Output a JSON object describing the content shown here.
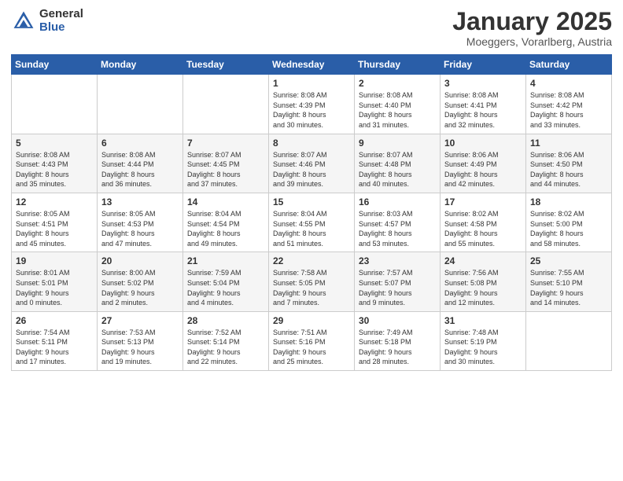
{
  "logo": {
    "general": "General",
    "blue": "Blue"
  },
  "header": {
    "month": "January 2025",
    "location": "Moeggers, Vorarlberg, Austria"
  },
  "weekdays": [
    "Sunday",
    "Monday",
    "Tuesday",
    "Wednesday",
    "Thursday",
    "Friday",
    "Saturday"
  ],
  "weeks": [
    [
      {
        "day": "",
        "sunrise": "",
        "sunset": "",
        "daylight": ""
      },
      {
        "day": "",
        "sunrise": "",
        "sunset": "",
        "daylight": ""
      },
      {
        "day": "",
        "sunrise": "",
        "sunset": "",
        "daylight": ""
      },
      {
        "day": "1",
        "sunrise": "Sunrise: 8:08 AM",
        "sunset": "Sunset: 4:39 PM",
        "daylight": "Daylight: 8 hours and 30 minutes."
      },
      {
        "day": "2",
        "sunrise": "Sunrise: 8:08 AM",
        "sunset": "Sunset: 4:40 PM",
        "daylight": "Daylight: 8 hours and 31 minutes."
      },
      {
        "day": "3",
        "sunrise": "Sunrise: 8:08 AM",
        "sunset": "Sunset: 4:41 PM",
        "daylight": "Daylight: 8 hours and 32 minutes."
      },
      {
        "day": "4",
        "sunrise": "Sunrise: 8:08 AM",
        "sunset": "Sunset: 4:42 PM",
        "daylight": "Daylight: 8 hours and 33 minutes."
      }
    ],
    [
      {
        "day": "5",
        "sunrise": "Sunrise: 8:08 AM",
        "sunset": "Sunset: 4:43 PM",
        "daylight": "Daylight: 8 hours and 35 minutes."
      },
      {
        "day": "6",
        "sunrise": "Sunrise: 8:08 AM",
        "sunset": "Sunset: 4:44 PM",
        "daylight": "Daylight: 8 hours and 36 minutes."
      },
      {
        "day": "7",
        "sunrise": "Sunrise: 8:07 AM",
        "sunset": "Sunset: 4:45 PM",
        "daylight": "Daylight: 8 hours and 37 minutes."
      },
      {
        "day": "8",
        "sunrise": "Sunrise: 8:07 AM",
        "sunset": "Sunset: 4:46 PM",
        "daylight": "Daylight: 8 hours and 39 minutes."
      },
      {
        "day": "9",
        "sunrise": "Sunrise: 8:07 AM",
        "sunset": "Sunset: 4:48 PM",
        "daylight": "Daylight: 8 hours and 40 minutes."
      },
      {
        "day": "10",
        "sunrise": "Sunrise: 8:06 AM",
        "sunset": "Sunset: 4:49 PM",
        "daylight": "Daylight: 8 hours and 42 minutes."
      },
      {
        "day": "11",
        "sunrise": "Sunrise: 8:06 AM",
        "sunset": "Sunset: 4:50 PM",
        "daylight": "Daylight: 8 hours and 44 minutes."
      }
    ],
    [
      {
        "day": "12",
        "sunrise": "Sunrise: 8:05 AM",
        "sunset": "Sunset: 4:51 PM",
        "daylight": "Daylight: 8 hours and 45 minutes."
      },
      {
        "day": "13",
        "sunrise": "Sunrise: 8:05 AM",
        "sunset": "Sunset: 4:53 PM",
        "daylight": "Daylight: 8 hours and 47 minutes."
      },
      {
        "day": "14",
        "sunrise": "Sunrise: 8:04 AM",
        "sunset": "Sunset: 4:54 PM",
        "daylight": "Daylight: 8 hours and 49 minutes."
      },
      {
        "day": "15",
        "sunrise": "Sunrise: 8:04 AM",
        "sunset": "Sunset: 4:55 PM",
        "daylight": "Daylight: 8 hours and 51 minutes."
      },
      {
        "day": "16",
        "sunrise": "Sunrise: 8:03 AM",
        "sunset": "Sunset: 4:57 PM",
        "daylight": "Daylight: 8 hours and 53 minutes."
      },
      {
        "day": "17",
        "sunrise": "Sunrise: 8:02 AM",
        "sunset": "Sunset: 4:58 PM",
        "daylight": "Daylight: 8 hours and 55 minutes."
      },
      {
        "day": "18",
        "sunrise": "Sunrise: 8:02 AM",
        "sunset": "Sunset: 5:00 PM",
        "daylight": "Daylight: 8 hours and 58 minutes."
      }
    ],
    [
      {
        "day": "19",
        "sunrise": "Sunrise: 8:01 AM",
        "sunset": "Sunset: 5:01 PM",
        "daylight": "Daylight: 9 hours and 0 minutes."
      },
      {
        "day": "20",
        "sunrise": "Sunrise: 8:00 AM",
        "sunset": "Sunset: 5:02 PM",
        "daylight": "Daylight: 9 hours and 2 minutes."
      },
      {
        "day": "21",
        "sunrise": "Sunrise: 7:59 AM",
        "sunset": "Sunset: 5:04 PM",
        "daylight": "Daylight: 9 hours and 4 minutes."
      },
      {
        "day": "22",
        "sunrise": "Sunrise: 7:58 AM",
        "sunset": "Sunset: 5:05 PM",
        "daylight": "Daylight: 9 hours and 7 minutes."
      },
      {
        "day": "23",
        "sunrise": "Sunrise: 7:57 AM",
        "sunset": "Sunset: 5:07 PM",
        "daylight": "Daylight: 9 hours and 9 minutes."
      },
      {
        "day": "24",
        "sunrise": "Sunrise: 7:56 AM",
        "sunset": "Sunset: 5:08 PM",
        "daylight": "Daylight: 9 hours and 12 minutes."
      },
      {
        "day": "25",
        "sunrise": "Sunrise: 7:55 AM",
        "sunset": "Sunset: 5:10 PM",
        "daylight": "Daylight: 9 hours and 14 minutes."
      }
    ],
    [
      {
        "day": "26",
        "sunrise": "Sunrise: 7:54 AM",
        "sunset": "Sunset: 5:11 PM",
        "daylight": "Daylight: 9 hours and 17 minutes."
      },
      {
        "day": "27",
        "sunrise": "Sunrise: 7:53 AM",
        "sunset": "Sunset: 5:13 PM",
        "daylight": "Daylight: 9 hours and 19 minutes."
      },
      {
        "day": "28",
        "sunrise": "Sunrise: 7:52 AM",
        "sunset": "Sunset: 5:14 PM",
        "daylight": "Daylight: 9 hours and 22 minutes."
      },
      {
        "day": "29",
        "sunrise": "Sunrise: 7:51 AM",
        "sunset": "Sunset: 5:16 PM",
        "daylight": "Daylight: 9 hours and 25 minutes."
      },
      {
        "day": "30",
        "sunrise": "Sunrise: 7:49 AM",
        "sunset": "Sunset: 5:18 PM",
        "daylight": "Daylight: 9 hours and 28 minutes."
      },
      {
        "day": "31",
        "sunrise": "Sunrise: 7:48 AM",
        "sunset": "Sunset: 5:19 PM",
        "daylight": "Daylight: 9 hours and 30 minutes."
      },
      {
        "day": "",
        "sunrise": "",
        "sunset": "",
        "daylight": ""
      }
    ]
  ]
}
